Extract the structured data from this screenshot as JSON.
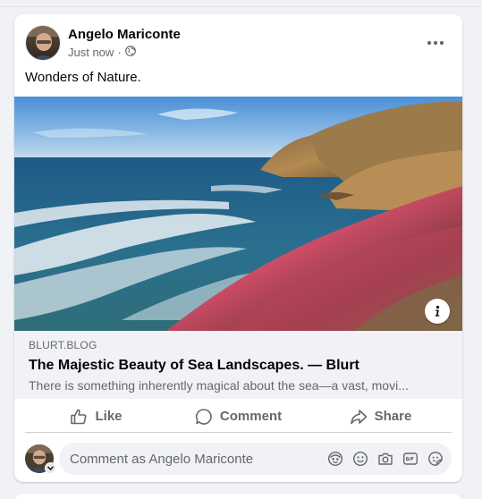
{
  "post": {
    "author": "Angelo Mariconte",
    "time": "Just now",
    "separator": "·",
    "audience_icon": "globe-icon",
    "caption": "Wonders of Nature."
  },
  "link_preview": {
    "domain": "BLURT.BLOG",
    "title": "The Majestic Beauty of Sea Landscapes. — Blurt",
    "description": "There is something inherently magical about the sea—a vast, movi..."
  },
  "actions": {
    "like": "Like",
    "comment": "Comment",
    "share": "Share"
  },
  "comment_box": {
    "placeholder": "Comment as Angelo Mariconte",
    "icons": [
      "avatar-sticker-icon",
      "emoji-icon",
      "camera-icon",
      "gif-icon",
      "sticker-icon"
    ]
  },
  "colors": {
    "page_bg": "#f0f2f5",
    "card_bg": "#ffffff",
    "secondary_text": "#65676b",
    "primary_text": "#050505"
  }
}
